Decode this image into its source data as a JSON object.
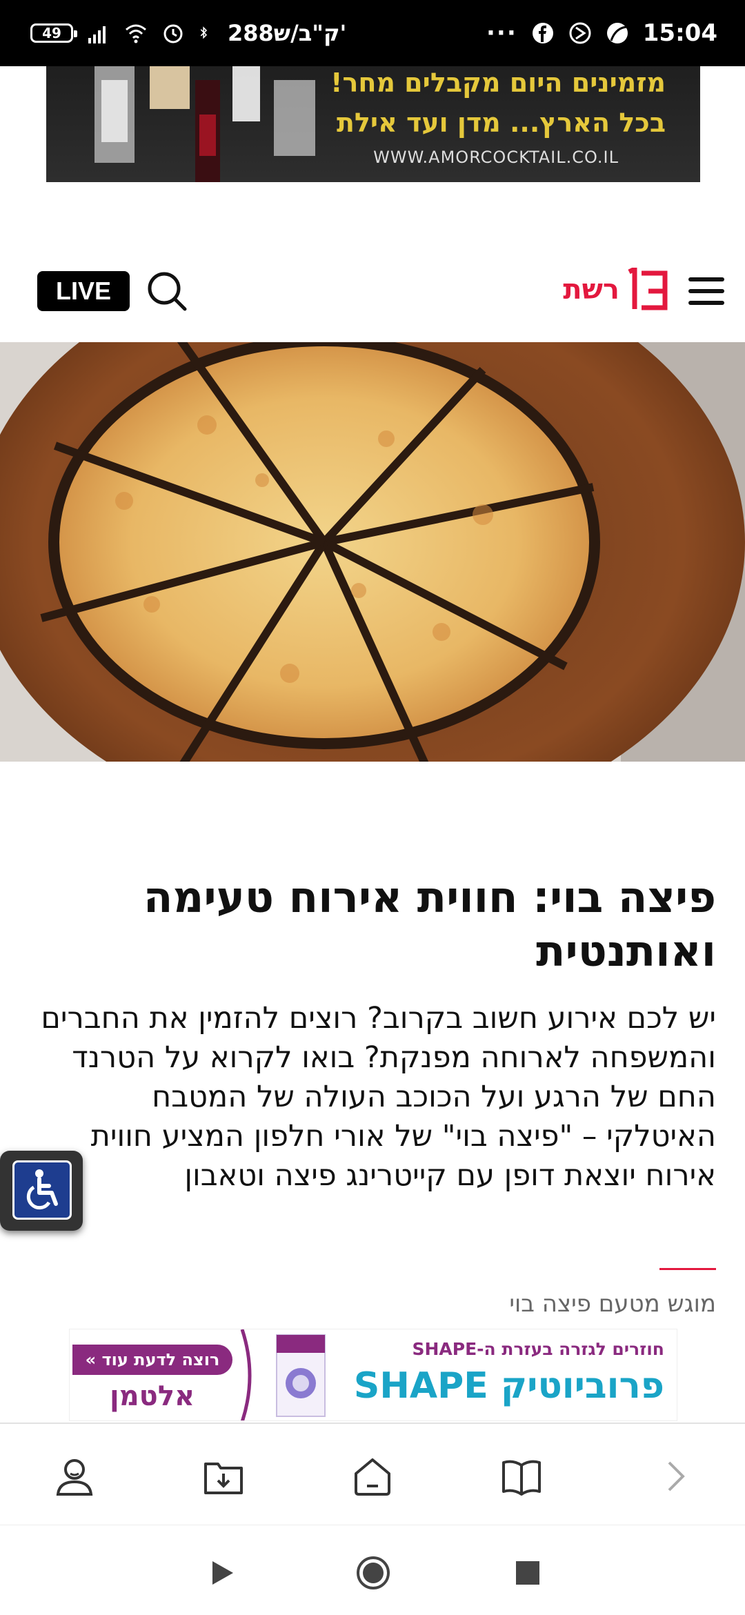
{
  "status_bar": {
    "battery": "49",
    "carrier": "288ק\"ב/ש'",
    "dots": "···",
    "time": "15:04"
  },
  "top_ad": {
    "line1": "מזמינים היום מקבלים מחר!",
    "line2": "בכל הארץ... מדן ועד אילת",
    "url": "WWW.AMORCOCKTAIL.CO.IL"
  },
  "header": {
    "live_label": "LIVE",
    "logo_text": "רשת",
    "logo_number": "13"
  },
  "article": {
    "headline": "פיצה בוי: חווית אירוח טעימה ואותנטית",
    "lead": "יש לכם אירוע חשוב בקרוב? רוצים להזמין את החברים והמשפחה לארוחה מפנקת? בואו לקרוא על הטרנד החם של הרגע ועל הכוכב העולה של המטבח האיטלקי – \"פיצה בוי\" של אורי חלפון המציע חווית אירוח יוצאת דופן עם קייטרינג פיצה וטאבון",
    "sponsor": "מוגש מטעם פיצה בוי"
  },
  "bottom_ad": {
    "cta": "רוצה לדעת עוד »",
    "brand": "אלטמן",
    "tagline": "חוזרים לגזרה בעזרת ה-SHAPE",
    "title": "פרוביוטיק SHAPE"
  },
  "colors": {
    "brand_red": "#e3183e",
    "ad_purple": "#8a2a7f",
    "ad_teal": "#1aa4c7",
    "ad_gold": "#e5c83b"
  }
}
